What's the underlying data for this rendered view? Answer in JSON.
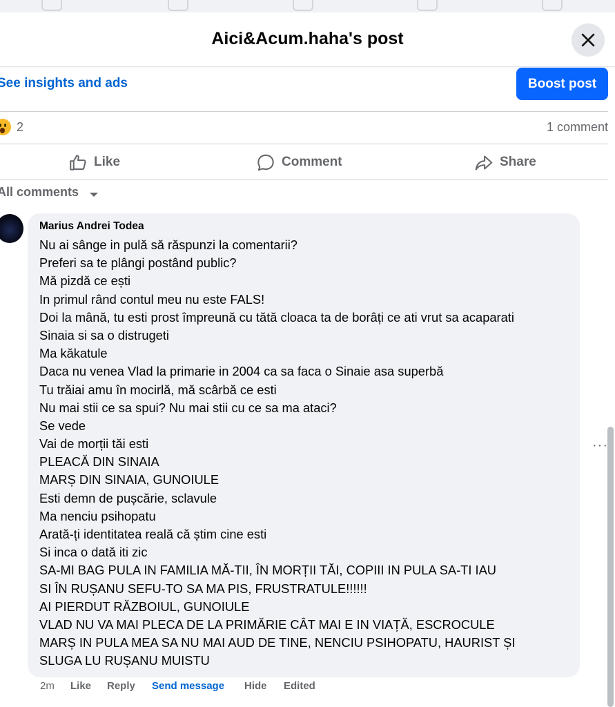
{
  "modal": {
    "title": "Aici&Acum.haha's post",
    "close_icon": "close-icon"
  },
  "insights": {
    "link_label": "See insights and ads",
    "boost_label": "Boost post"
  },
  "reactions": {
    "emoji": "wow-reaction-icon",
    "count": "2",
    "comment_count": "1 comment"
  },
  "actions": {
    "like": "Like",
    "comment": "Comment",
    "share": "Share"
  },
  "comments_filter": {
    "label": "All comments"
  },
  "comment": {
    "author": "Marius Andrei Todea",
    "lines": [
      "Nu ai sânge in pulă să răspunzi la comentarii?",
      "Preferi sa te plângi postând public?",
      "Mă pizdă ce ești",
      "In primul rând contul meu nu este FALS!",
      "Doi la mână, tu esti prost împreună cu tătă cloaca ta de borâți ce ati vrut sa acaparati",
      "Sinaia si sa o distrugeti",
      "Ma kăkatule",
      "Daca nu venea Vlad la primarie in 2004 ca sa faca o Sinaie asa superbă",
      "Tu trăiai amu în mocirlă, mă scârbă ce esti",
      "Nu mai stii ce sa spui? Nu mai stii cu ce sa ma ataci?",
      "Se vede",
      "Vai de morții tăi esti",
      "PLEACĂ DIN SINAIA",
      "MARȘ DIN SINAIA, GUNOIULE",
      "Esti demn de pușcărie, sclavule",
      "Ma nenciu psihopatu",
      "Arată-ți identitatea reală că știm cine esti",
      "Si inca o dată iti zic",
      "SA-MI BAG PULA IN FAMILIA MĂ-TII, ÎN MORȚII TĂI, COPIII IN PULA SA-TI IAU",
      "SI ÎN RUȘANU SEFU-TO SA MA PIS, FRUSTRATULE!!!!!!",
      "AI PIERDUT RĂZBOIUL, GUNOIULE",
      "VLAD NU VA MAI PLECA DE LA PRIMĂRIE CÂT MAI E IN VIAȚĂ, ESCROCULE",
      "MARȘ IN PULA MEA SA NU MAI AUD DE TINE, NENCIU PSIHOPATU, HAURIST ȘI",
      "SLUGA LU RUȘANU MUISTU"
    ],
    "more_label": "···",
    "meta": {
      "time": "2m",
      "like": "Like",
      "reply": "Reply",
      "send_message": "Send message",
      "hide": "Hide",
      "edited": "Edited"
    }
  },
  "colors": {
    "accent": "#0866ff",
    "link": "#0064d1",
    "muted": "#65676b",
    "bubble": "#f0f2f5"
  }
}
